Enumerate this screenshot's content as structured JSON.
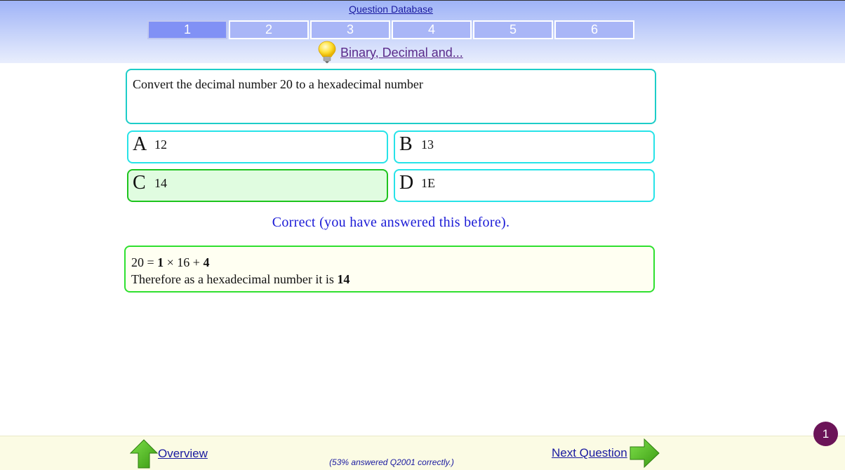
{
  "header": {
    "database_link": "Question Database",
    "tabs": [
      "1",
      "2",
      "3",
      "4",
      "5",
      "6"
    ],
    "active_tab": "1",
    "topic_link": "Binary, Decimal and...",
    "topic_icon": "lightbulb-icon"
  },
  "question": {
    "text": "Convert the decimal number 20 to a hexadecimal number"
  },
  "answers": [
    {
      "letter": "A",
      "value": "12"
    },
    {
      "letter": "B",
      "value": "13"
    },
    {
      "letter": "C",
      "value": "14",
      "correct": true
    },
    {
      "letter": "D",
      "value": "1E"
    }
  ],
  "feedback": "Correct (you have answered this before).",
  "explanation": {
    "line1_prefix": "20 = ",
    "line1_quotient": "1",
    "line1_middle": " × 16 + ",
    "line1_remainder": "4",
    "line2_prefix": "Therefore as a hexadecimal number it is ",
    "line2_answer": "14"
  },
  "footer": {
    "overview_link": "Overview",
    "next_link": "Next Question",
    "stats": "(53% answered Q2001 correctly.)"
  },
  "badge": "1",
  "colors": {
    "tab_bg": "#a9b6f7",
    "tab_active_bg": "#8191f5",
    "question_border": "#1dcdc8",
    "answer_border": "#27e3e8",
    "correct_border": "#1ec41e",
    "correct_bg": "#e0fce0",
    "feedback_text": "#1a1ad6",
    "arrow_green": "#4cbf1f",
    "badge_bg": "#6b1458"
  }
}
